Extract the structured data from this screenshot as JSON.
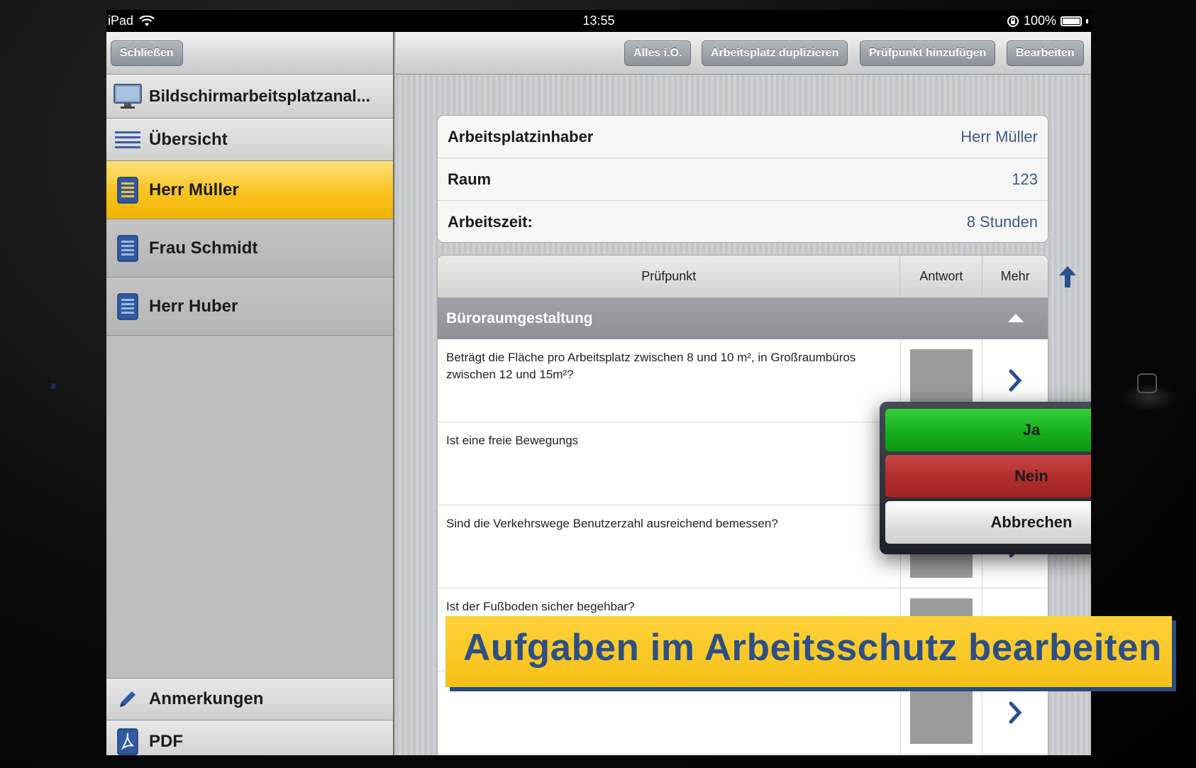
{
  "status_bar": {
    "device": "iPad",
    "time": "13:55",
    "battery": "100%"
  },
  "master": {
    "close_label": "Schließen",
    "app_title": "Bildschirmarbeitsplatzanal...",
    "overview_label": "Übersicht",
    "people": [
      {
        "label": "Herr Müller",
        "selected": true
      },
      {
        "label": "Frau Schmidt",
        "selected": false
      },
      {
        "label": "Herr Huber",
        "selected": false
      }
    ],
    "notes_label": "Anmerkungen",
    "pdf_label": "PDF"
  },
  "toolbar": {
    "all_ok": "Alles i.O.",
    "duplicate": "Arbeitsplatz duplizieren",
    "add_point": "Prüfpunkt hinzufügen",
    "edit": "Bearbeiten"
  },
  "info": {
    "rows": [
      {
        "label": "Arbeitsplatzinhaber",
        "value": "Herr Müller"
      },
      {
        "label": "Raum",
        "value": "123"
      },
      {
        "label": "Arbeitszeit:",
        "value": "8 Stunden"
      }
    ]
  },
  "table": {
    "headers": {
      "point": "Prüfpunkt",
      "answer": "Antwort",
      "more": "Mehr"
    },
    "section": "Büroraumgestaltung",
    "rows": [
      {
        "question": "Beträgt die Fläche pro Arbeitsplatz zwischen 8 und 10 m², in Großraumbüros zwischen 12 und 15m²?"
      },
      {
        "question": "Ist eine freie Bewegungs"
      },
      {
        "question": "Sind die Verkehrswege Benutzerzahl ausreichend bemessen?"
      },
      {
        "question": "Ist der Fußboden sicher begehbar?"
      },
      {
        "question": ""
      }
    ]
  },
  "popover": {
    "yes": "Ja",
    "no": "Nein",
    "cancel": "Abbrechen"
  },
  "banner": {
    "text": "Aufgaben im Arbeitsschutz bearbeiten"
  },
  "colors": {
    "selected_row": "#f9c320",
    "yes": "#16ad1c",
    "no": "#b12d2d",
    "banner": "#fdd23a",
    "banner_text": "#2d4f86",
    "accent_blue": "#2b4f8e"
  },
  "icons": [
    "wifi-icon",
    "rotation-lock-icon",
    "battery-icon",
    "monitor-icon",
    "list-icon",
    "document-icon",
    "pencil-icon",
    "pdf-icon",
    "chevron-right-icon",
    "arrow-up-icon",
    "collapse-triangle-icon"
  ]
}
